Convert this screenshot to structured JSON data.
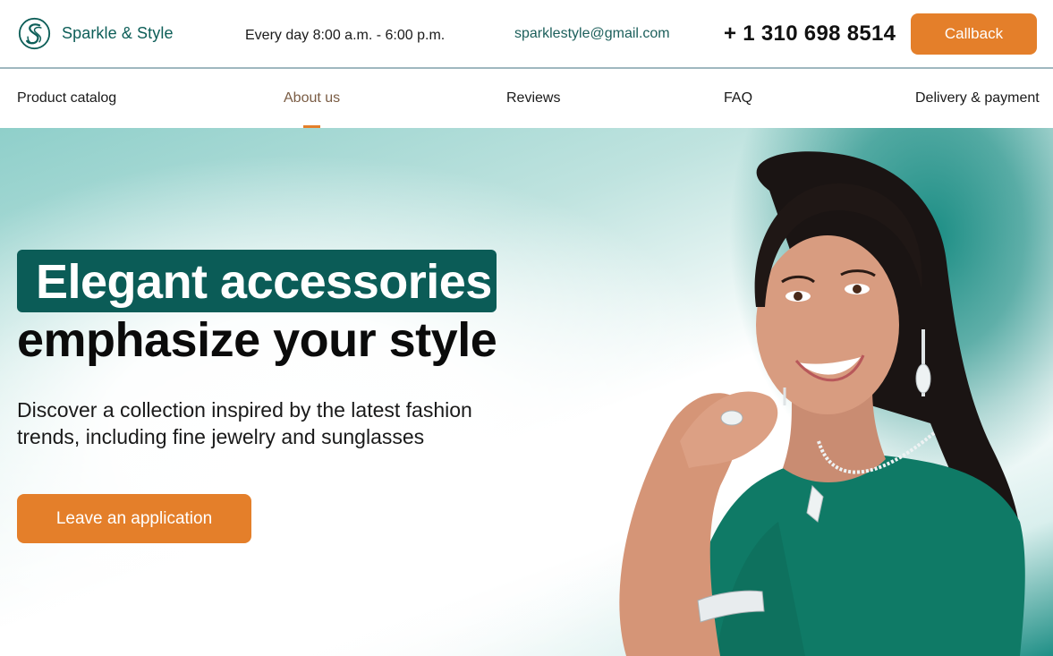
{
  "header": {
    "brand": "Sparkle & Style",
    "hours": "Every day 8:00 a.m. - 6:00 p.m.",
    "email": "sparklestyle@gmail.com",
    "phone": "+ 1 310 698 8514",
    "callback_label": "Callback"
  },
  "nav": {
    "items": [
      {
        "label": "Product catalog"
      },
      {
        "label": "About us",
        "active": true
      },
      {
        "label": "Reviews"
      },
      {
        "label": "FAQ"
      },
      {
        "label": "Delivery & payment"
      }
    ]
  },
  "hero": {
    "headline_highlight": "Elegant accessories",
    "headline_rest": "emphasize your style",
    "subtitle_line1": "Discover a collection inspired by the latest fashion",
    "subtitle_line2": "trends, including fine jewelry and sunglasses",
    "cta_label": "Leave an application"
  },
  "colors": {
    "accent": "#e47f2a",
    "brand_teal": "#0b5c57",
    "email_teal": "#1c5f5b"
  },
  "icons": {
    "logo": "ss-monogram-logo-icon"
  }
}
